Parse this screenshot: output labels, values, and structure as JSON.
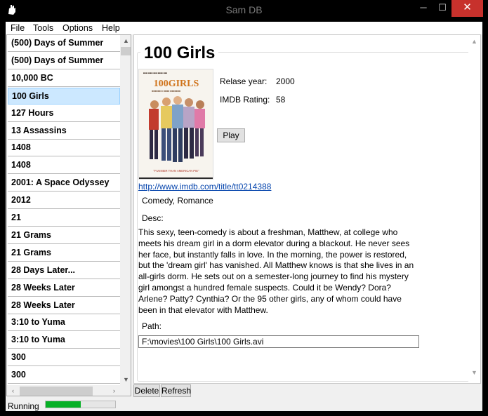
{
  "window": {
    "title": "Sam DB",
    "minimize_glyph": "─",
    "maximize_glyph": "☐",
    "close_glyph": "✕",
    "app_icon": "hand-icon"
  },
  "menu": [
    "File",
    "Tools",
    "Options",
    "Help"
  ],
  "movie_list": {
    "selected_index": 3,
    "items": [
      "(500) Days of Summer",
      "(500) Days of Summer",
      "10,000 BC",
      "100 Girls",
      "127 Hours",
      "13 Assassins",
      "1408",
      "1408",
      "2001: A Space Odyssey",
      "2012",
      "21",
      "21 Grams",
      "21 Grams",
      "28 Days Later...",
      "28 Weeks Later",
      "28 Weeks Later",
      "3:10 to Yuma",
      "3:10 to Yuma",
      "300",
      "300"
    ]
  },
  "detail": {
    "title": "100 Girls",
    "release_label": "Relase year:",
    "release_value": "2000",
    "rating_label": "IMDB Rating:",
    "rating_value": "58",
    "play_label": "Play",
    "imdb_url": "http://www.imdb.com/title/tt0214388",
    "genres": "Comedy, Romance",
    "desc_label": "Desc:",
    "description": "This sexy, teen-comedy is about a freshman, Matthew, at college who meets his dream girl in a dorm elevator during a blackout. He never sees her face, but instantly falls in love. In the morning, the power is restored, but the 'dream girl' has vanished. All Matthew knows is that she lives in an all-girls dorm. He sets out on a semester-long journey to find his mystery girl amongst a hundred female suspects. Could it be Wendy? Dora? Arlene? Patty? Cynthia? Or the 95 other girls, any of whom could have been in that elevator with Matthew.",
    "path_label": "Path:",
    "path_value": "F:\\movies\\100 Girls\\100 Girls.avi",
    "poster": {
      "title_art": "100GIRLS",
      "tagline": "\"FUNNIER THAN AMERICAN PIE\""
    }
  },
  "buttons": {
    "delete": "Delete",
    "refresh": "Refresh"
  },
  "status": {
    "text": "Running",
    "progress": 0.5,
    "progress_color": "#06b025"
  },
  "colors": {
    "selection": "#cce8ff",
    "close_button": "#c7312c",
    "link": "#0645ad"
  }
}
